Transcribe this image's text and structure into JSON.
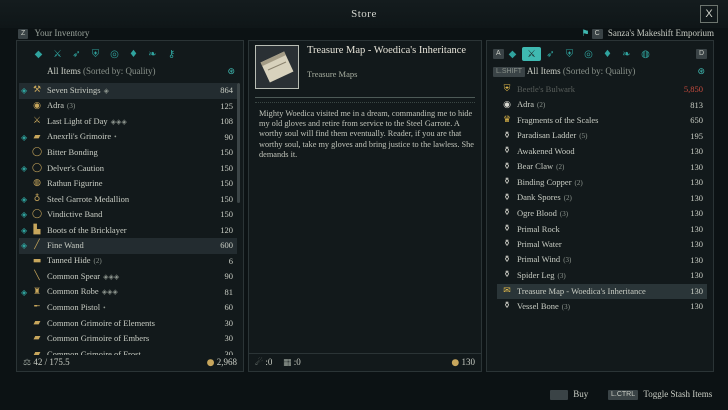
{
  "window": {
    "title": "Store",
    "close_label": "X"
  },
  "inventory": {
    "key": "Z",
    "label": "Your Inventory",
    "tabs": [
      {
        "icon": "gem-icon",
        "glyph": "◆"
      },
      {
        "icon": "sword-icon",
        "glyph": "⚔"
      },
      {
        "icon": "bow-icon",
        "glyph": "➶"
      },
      {
        "icon": "shield-icon",
        "glyph": "⛨"
      },
      {
        "icon": "ring-icon",
        "glyph": "◎"
      },
      {
        "icon": "potion-icon",
        "glyph": "♦"
      },
      {
        "icon": "scroll-icon",
        "glyph": "❧"
      },
      {
        "icon": "key-icon",
        "glyph": "⚷"
      }
    ],
    "sort_label": "All Items",
    "sort_suffix": "(Sorted by: Quality)",
    "items": [
      {
        "name": "Seven Strivings",
        "tag": "◈",
        "value": "864",
        "icon": "axe-icon",
        "glyph": "⚒",
        "pinned": true,
        "highlight": true
      },
      {
        "name": "Adra",
        "tag": "(3)",
        "value": "125",
        "icon": "adra-icon",
        "glyph": "◉",
        "pinned": false
      },
      {
        "name": "Last Light of Day",
        "tag": "◈◈◈",
        "value": "108",
        "icon": "sword-icon",
        "glyph": "⚔",
        "pinned": false
      },
      {
        "name": "Anexrli's Grimoire",
        "tag": "•",
        "value": "90",
        "icon": "grimoire-icon",
        "glyph": "▰",
        "pinned": true
      },
      {
        "name": "Bitter Bonding",
        "tag": "",
        "value": "150",
        "icon": "ring-icon",
        "glyph": "◯",
        "pinned": false
      },
      {
        "name": "Delver's Caution",
        "tag": "",
        "value": "150",
        "icon": "ring-icon",
        "glyph": "◯",
        "pinned": true
      },
      {
        "name": "Rathun Figurine",
        "tag": "",
        "value": "150",
        "icon": "figurine-icon",
        "glyph": "◍",
        "pinned": false
      },
      {
        "name": "Steel Garrote Medallion",
        "tag": "",
        "value": "150",
        "icon": "amulet-icon",
        "glyph": "♁",
        "pinned": true
      },
      {
        "name": "Vindictive Band",
        "tag": "",
        "value": "150",
        "icon": "ring-icon",
        "glyph": "◯",
        "pinned": true
      },
      {
        "name": "Boots of the Bricklayer",
        "tag": "",
        "value": "120",
        "icon": "boots-icon",
        "glyph": "▙",
        "pinned": true
      },
      {
        "name": "Fine Wand",
        "tag": "",
        "value": "600",
        "icon": "wand-icon",
        "glyph": "╱",
        "pinned": true,
        "highlight": true
      },
      {
        "name": "Tanned Hide",
        "tag": "(2)",
        "value": "6",
        "icon": "hide-icon",
        "glyph": "▬",
        "pinned": false
      },
      {
        "name": "Common Spear",
        "tag": "◈◈◈",
        "value": "90",
        "icon": "spear-icon",
        "glyph": "╲",
        "pinned": false
      },
      {
        "name": "Common Robe",
        "tag": "◈◈◈",
        "value": "81",
        "icon": "robe-icon",
        "glyph": "♜",
        "pinned": true
      },
      {
        "name": "Common Pistol",
        "tag": "•",
        "value": "60",
        "icon": "pistol-icon",
        "glyph": "╾",
        "pinned": false
      },
      {
        "name": "Common Grimoire of Elements",
        "tag": "",
        "value": "30",
        "icon": "grimoire-icon",
        "glyph": "▰",
        "pinned": false
      },
      {
        "name": "Common Grimoire of Embers",
        "tag": "",
        "value": "30",
        "icon": "grimoire-icon",
        "glyph": "▰",
        "pinned": false
      },
      {
        "name": "Common Grimoire of Frost",
        "tag": "",
        "value": "30",
        "icon": "grimoire-icon",
        "glyph": "▰",
        "pinned": false
      }
    ],
    "weight": "42 / 175.5",
    "gold": "2,968"
  },
  "detail": {
    "title": "Treasure Map - Woedica's Inheritance",
    "category": "Treasure Maps",
    "description": "Mighty Woedica visited me in a dream, commanding me to hide my old gloves and retire from service to the Steel Garrote. A worthy soul will find them eventually. Reader, if you are that worthy soul, take my gloves and bring justice to the lawless. She demands it.",
    "stat1": ":0",
    "stat2": ":0",
    "price": "130"
  },
  "vendor": {
    "name": "Sanza's Makeshift Emporium",
    "key_left": "A",
    "key_right": "D",
    "key_sort": "L.SHIFT",
    "sort_label": "All Items",
    "sort_suffix": "(Sorted by: Quality)",
    "items": [
      {
        "name": "Beetle's Bulwark",
        "tag": "",
        "value": "5,850",
        "icon": "shield-icon",
        "glyph": "⛨",
        "red": true
      },
      {
        "name": "Adra",
        "tag": "(2)",
        "value": "813",
        "icon": "adra-icon",
        "glyph": "◉"
      },
      {
        "name": "Fragments of the Scales",
        "tag": "",
        "value": "650",
        "icon": "crown-icon",
        "glyph": "♛"
      },
      {
        "name": "Paradisan Ladder",
        "tag": "(5)",
        "value": "195",
        "icon": "ingredient-icon",
        "glyph": "⚱"
      },
      {
        "name": "Awakened Wood",
        "tag": "",
        "value": "130",
        "icon": "ingredient-icon",
        "glyph": "⚱"
      },
      {
        "name": "Bear Claw",
        "tag": "(2)",
        "value": "130",
        "icon": "ingredient-icon",
        "glyph": "⚱"
      },
      {
        "name": "Binding Copper",
        "tag": "(2)",
        "value": "130",
        "icon": "ingredient-icon",
        "glyph": "⚱"
      },
      {
        "name": "Dank Spores",
        "tag": "(2)",
        "value": "130",
        "icon": "ingredient-icon",
        "glyph": "⚱"
      },
      {
        "name": "Ogre Blood",
        "tag": "(3)",
        "value": "130",
        "icon": "ingredient-icon",
        "glyph": "⚱"
      },
      {
        "name": "Primal Rock",
        "tag": "",
        "value": "130",
        "icon": "ingredient-icon",
        "glyph": "⚱"
      },
      {
        "name": "Primal Water",
        "tag": "",
        "value": "130",
        "icon": "ingredient-icon",
        "glyph": "⚱"
      },
      {
        "name": "Primal Wind",
        "tag": "(3)",
        "value": "130",
        "icon": "ingredient-icon",
        "glyph": "⚱"
      },
      {
        "name": "Spider Leg",
        "tag": "(3)",
        "value": "130",
        "icon": "ingredient-icon",
        "glyph": "⚱"
      },
      {
        "name": "Treasure Map - Woedica's Inheritance",
        "tag": "",
        "value": "130",
        "icon": "map-icon",
        "glyph": "✉",
        "selected": true
      },
      {
        "name": "Vessel Bone",
        "tag": "(3)",
        "value": "130",
        "icon": "ingredient-icon",
        "glyph": "⚱"
      }
    ]
  },
  "hints": {
    "buy_label": "Buy",
    "buy_key": "",
    "stash_label": "Toggle Stash Items",
    "stash_key": "L.CTRL"
  },
  "colors": {
    "accent": "#3fb9b1",
    "gold": "#c7a65c",
    "expensive": "#c84b3e"
  }
}
